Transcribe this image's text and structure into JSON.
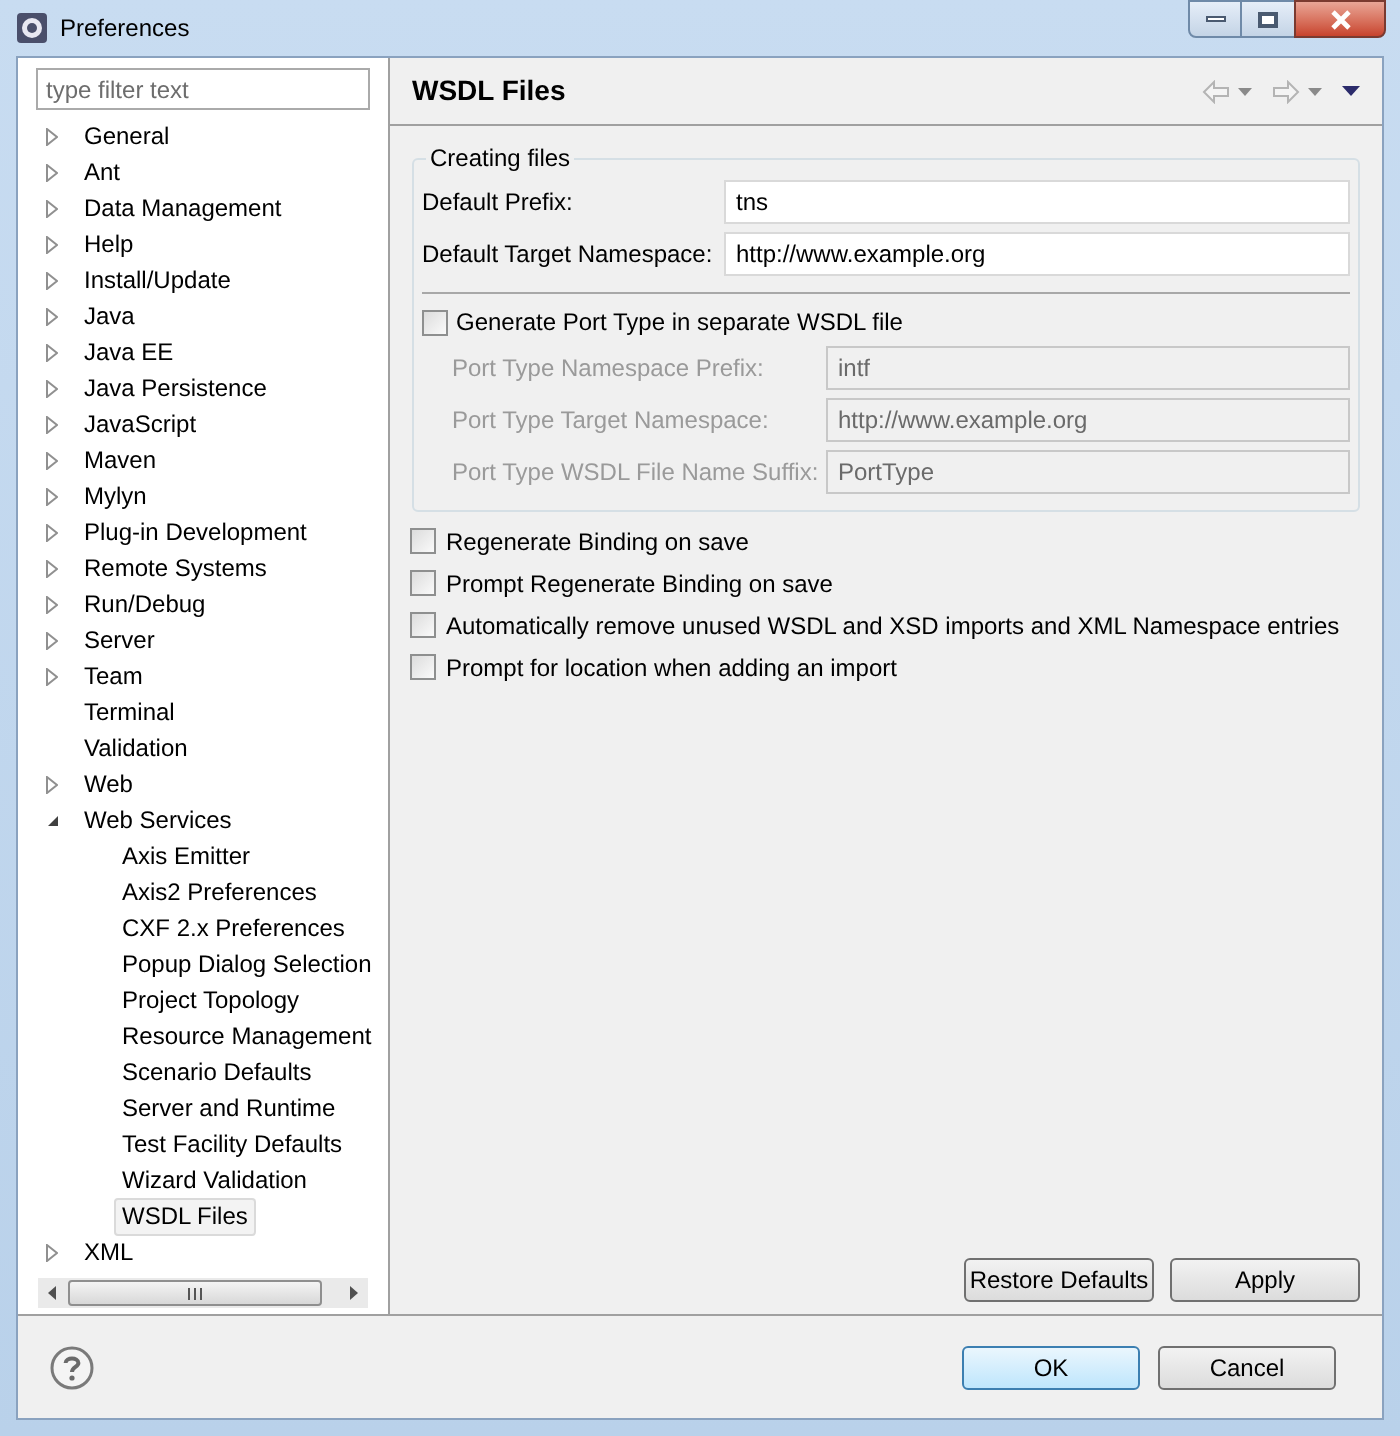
{
  "window": {
    "title": "Preferences"
  },
  "filter": {
    "placeholder": "type filter text"
  },
  "tree": [
    {
      "label": "General",
      "kind": "node",
      "expanded": false,
      "selected": false
    },
    {
      "label": "Ant",
      "kind": "node",
      "expanded": false,
      "selected": false
    },
    {
      "label": "Data Management",
      "kind": "node",
      "expanded": false,
      "selected": false
    },
    {
      "label": "Help",
      "kind": "node",
      "expanded": false,
      "selected": false
    },
    {
      "label": "Install/Update",
      "kind": "node",
      "expanded": false,
      "selected": false
    },
    {
      "label": "Java",
      "kind": "node",
      "expanded": false,
      "selected": false
    },
    {
      "label": "Java EE",
      "kind": "node",
      "expanded": false,
      "selected": false
    },
    {
      "label": "Java Persistence",
      "kind": "node",
      "expanded": false,
      "selected": false
    },
    {
      "label": "JavaScript",
      "kind": "node",
      "expanded": false,
      "selected": false
    },
    {
      "label": "Maven",
      "kind": "node",
      "expanded": false,
      "selected": false
    },
    {
      "label": "Mylyn",
      "kind": "node",
      "expanded": false,
      "selected": false
    },
    {
      "label": "Plug-in Development",
      "kind": "node",
      "expanded": false,
      "selected": false
    },
    {
      "label": "Remote Systems",
      "kind": "node",
      "expanded": false,
      "selected": false
    },
    {
      "label": "Run/Debug",
      "kind": "node",
      "expanded": false,
      "selected": false
    },
    {
      "label": "Server",
      "kind": "node",
      "expanded": false,
      "selected": false
    },
    {
      "label": "Team",
      "kind": "node",
      "expanded": false,
      "selected": false
    },
    {
      "label": "Terminal",
      "kind": "leaf",
      "selected": false
    },
    {
      "label": "Validation",
      "kind": "leaf",
      "selected": false
    },
    {
      "label": "Web",
      "kind": "node",
      "expanded": false,
      "selected": false
    },
    {
      "label": "Web Services",
      "kind": "node",
      "expanded": true,
      "selected": false,
      "children": [
        {
          "label": "Axis Emitter",
          "kind": "leaf",
          "selected": false
        },
        {
          "label": "Axis2 Preferences",
          "kind": "leaf",
          "selected": false
        },
        {
          "label": "CXF 2.x Preferences",
          "kind": "leaf",
          "selected": false
        },
        {
          "label": "Popup Dialog Selection",
          "kind": "leaf",
          "selected": false
        },
        {
          "label": "Project Topology",
          "kind": "leaf",
          "selected": false
        },
        {
          "label": "Resource Management",
          "kind": "leaf",
          "selected": false
        },
        {
          "label": "Scenario Defaults",
          "kind": "leaf",
          "selected": false
        },
        {
          "label": "Server and Runtime",
          "kind": "leaf",
          "selected": false
        },
        {
          "label": "Test Facility Defaults",
          "kind": "leaf",
          "selected": false
        },
        {
          "label": "Wizard Validation",
          "kind": "leaf",
          "selected": false
        },
        {
          "label": "WSDL Files",
          "kind": "leaf",
          "selected": true
        }
      ]
    },
    {
      "label": "XML",
      "kind": "node",
      "expanded": false,
      "selected": false
    }
  ],
  "page": {
    "title": "WSDL Files",
    "group": {
      "title": "Creating files",
      "fields": [
        {
          "label": "Default Prefix:",
          "value": "tns",
          "disabled": false
        },
        {
          "label": "Default Target Namespace:",
          "value": "http://www.example.org",
          "disabled": false
        }
      ],
      "port_type_checkbox": {
        "label": "Generate Port Type in separate WSDL file",
        "checked": false
      },
      "port_fields": [
        {
          "label": "Port Type Namespace Prefix:",
          "value": "intf",
          "disabled": true
        },
        {
          "label": "Port Type Target Namespace:",
          "value": "http://www.example.org",
          "disabled": true
        },
        {
          "label": "Port Type WSDL File Name Suffix:",
          "value": "PortType",
          "disabled": true
        }
      ]
    },
    "checkboxes": [
      {
        "label": "Regenerate Binding on save",
        "checked": false
      },
      {
        "label": "Prompt Regenerate Binding on save",
        "checked": false
      },
      {
        "label": "Automatically remove unused WSDL and XSD imports and XML Namespace entries",
        "checked": false
      },
      {
        "label": "Prompt for location when adding an import",
        "checked": false
      }
    ],
    "buttons": [
      "Restore Defaults",
      "Apply"
    ]
  },
  "footer": {
    "buttons": [
      {
        "label": "OK",
        "selected": true
      },
      {
        "label": "Cancel",
        "selected": false
      }
    ]
  }
}
